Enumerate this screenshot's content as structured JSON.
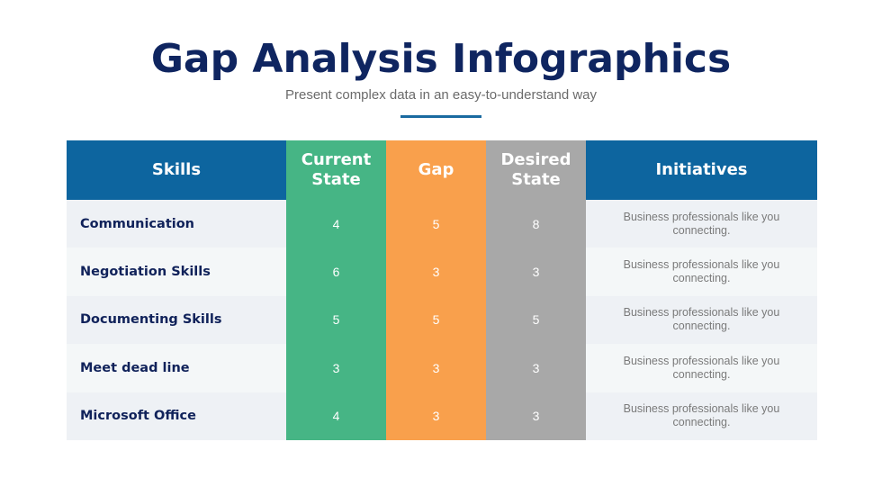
{
  "header": {
    "title": "Gap Analysis Infographics",
    "subtitle": "Present complex data in an easy-to-understand way"
  },
  "colors": {
    "title": "#0f2560",
    "header_blue": "#0d659f",
    "current_state": "#46b585",
    "gap": "#f9a04c",
    "desired_state": "#a8a8a8"
  },
  "table": {
    "columns": {
      "skills": "Skills",
      "current": "Current State",
      "gap": "Gap",
      "desired": "Desired State",
      "initiatives": "Initiatives"
    },
    "rows": [
      {
        "skill": "Communication",
        "current": "4",
        "gap": "5",
        "desired": "8",
        "initiative": "Business professionals like you connecting."
      },
      {
        "skill": "Negotiation Skills",
        "current": "6",
        "gap": "3",
        "desired": "3",
        "initiative": "Business professionals like you connecting."
      },
      {
        "skill": "Documenting Skills",
        "current": "5",
        "gap": "5",
        "desired": "5",
        "initiative": "Business professionals like you connecting."
      },
      {
        "skill": "Meet dead line",
        "current": "3",
        "gap": "3",
        "desired": "3",
        "initiative": "Business professionals like you connecting."
      },
      {
        "skill": "Microsoft Office",
        "current": "4",
        "gap": "3",
        "desired": "3",
        "initiative": "Business professionals like you connecting."
      }
    ]
  }
}
